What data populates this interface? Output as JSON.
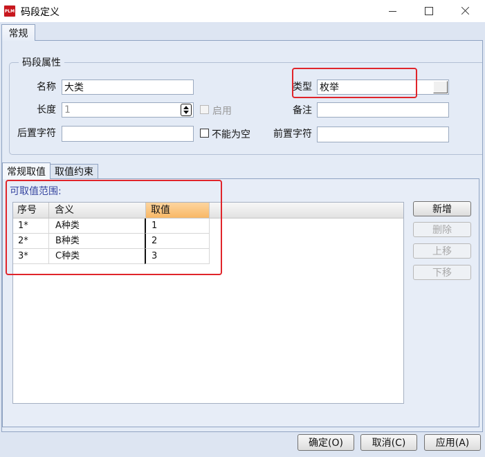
{
  "window": {
    "title": "码段定义",
    "logo_text": "PLM"
  },
  "icons": {
    "app": "plm-logo-icon",
    "minimize": "minimize-icon",
    "maximize": "maximize-icon",
    "close": "close-icon",
    "type_dropdown": "dropdown-icon",
    "length_spinner": "spinner-arrows-icon"
  },
  "main_tabs": [
    {
      "label": "常规",
      "selected": true
    }
  ],
  "attributes_group": {
    "title": "码段属性",
    "name": {
      "label": "名称",
      "value": "大类"
    },
    "type": {
      "label": "类型",
      "value": "枚举"
    },
    "length": {
      "label": "长度",
      "value": "1",
      "disabled": true
    },
    "enabled": {
      "label": "启用",
      "checked": false,
      "disabled": true
    },
    "remark": {
      "label": "备注",
      "value": ""
    },
    "suffix": {
      "label": "后置字符",
      "value": ""
    },
    "not_empty": {
      "label": "不能为空",
      "checked": false
    },
    "prefix": {
      "label": "前置字符",
      "value": ""
    }
  },
  "sub_tabs": [
    {
      "label": "常规取值",
      "selected": true
    },
    {
      "label": "取值约束",
      "selected": false
    }
  ],
  "value_range": {
    "label": "可取值范围:",
    "columns": [
      "序号",
      "含义",
      "取值"
    ],
    "selected_column": 2,
    "rows": [
      [
        "1*",
        "A种类",
        "1"
      ],
      [
        "2*",
        "B种类",
        "2"
      ],
      [
        "3*",
        "C种类",
        "3"
      ]
    ]
  },
  "side_buttons": [
    {
      "label": "新增",
      "enabled": true
    },
    {
      "label": "删除",
      "enabled": false
    },
    {
      "label": "上移",
      "enabled": false
    },
    {
      "label": "下移",
      "enabled": false
    }
  ],
  "footer_buttons": {
    "ok": "确定(O)",
    "cancel": "取消(C)",
    "apply": "应用(A)"
  },
  "colors": {
    "highlight_border": "#e0242a",
    "selected_column_header": "#fbc47e",
    "section_label": "#3645a0",
    "logo_bg": "#c8171e"
  }
}
